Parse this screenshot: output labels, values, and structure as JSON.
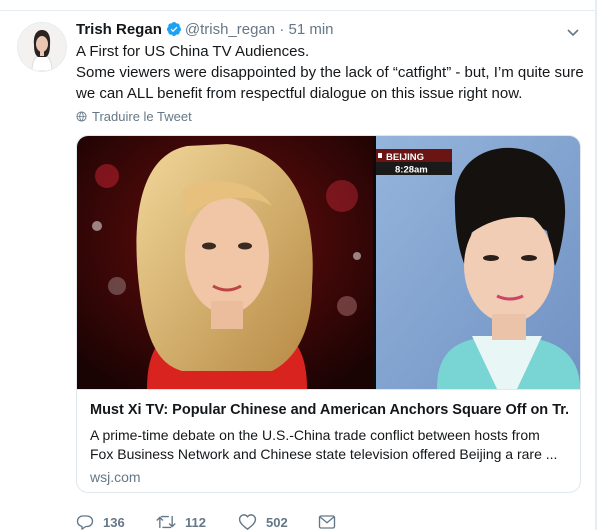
{
  "tweet": {
    "author_name": "Trish Regan",
    "handle": "@trish_regan",
    "separator": "·",
    "time": "51 min",
    "text_lines": [
      "A First for US China TV Audiences.",
      "Some viewers were disappointed by the lack of “catfight” - but, I’m quite sure",
      "we can ALL benefit from respectful dialogue on this issue right now."
    ],
    "translate_label": "Traduire le Tweet"
  },
  "card": {
    "overlay_city": "BEIJING",
    "overlay_time": "8:28am",
    "title": "Must Xi TV: Popular Chinese and American Anchors Square Off on Tr...",
    "description_lines": [
      "A prime-time debate on the U.S.-China trade conflict between hosts from",
      "Fox Business Network and Chinese state television offered Beijing a rare ..."
    ],
    "domain": "wsj.com"
  },
  "actions": {
    "replies": "136",
    "retweets": "112",
    "likes": "502"
  },
  "colors": {
    "verified": "#1da1f2",
    "muted": "#657786",
    "text": "#14171a"
  }
}
